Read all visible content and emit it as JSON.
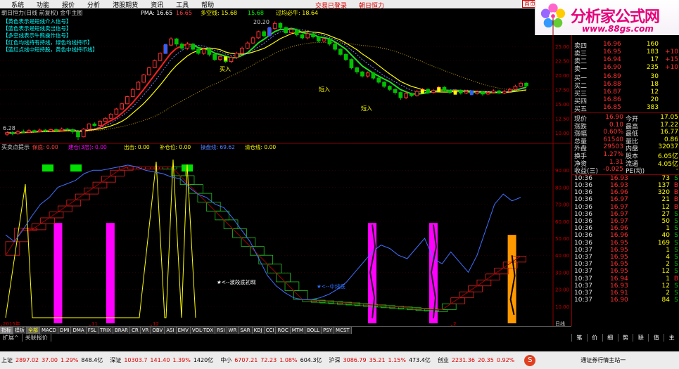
{
  "menu": {
    "items": [
      "系统",
      "功能",
      "报价",
      "分析",
      "港股期货",
      "资讯",
      "工具",
      "帮助"
    ],
    "link1": "交易已登录",
    "link2": "朝日恒力",
    "right_btn": "首页"
  },
  "logo": {
    "title": "分析家公式网",
    "url": "www.88gs.com"
  },
  "main_chart": {
    "header": "朝日恒力(日线 前复权) 金牛主图",
    "pma_label": "PMA: 16.65",
    "pma_val2": "16.65",
    "ma_label": "多空线: 15.68",
    "ma_val2": "15.68",
    "right_label": "过均必牛: 18.64",
    "legend": [
      "【黄色表示是短线介入信号】",
      "【蓝色表示是短线卖出信号】",
      "【多空线表示牛熊操作信号】",
      "【红色均线持有持线，绿色均线持币】",
      "【蓝红点线中短持股，黄色中线持币线】"
    ],
    "peak_label": "20.20",
    "low_label": "6.28",
    "entry_labels": [
      "买入",
      "短入",
      "短入"
    ],
    "y_ticks": [
      "25.00",
      "22.50",
      "20.00",
      "17.50",
      "15.00",
      "12.50",
      "10.00"
    ],
    "candles": [
      {
        "o": 7.5,
        "c": 7.8,
        "h": 8.0,
        "l": 7.2
      },
      {
        "o": 7.8,
        "c": 7.6,
        "h": 8.1,
        "l": 7.3
      },
      {
        "o": 7.6,
        "c": 8.0,
        "h": 8.3,
        "l": 7.4
      },
      {
        "o": 8.0,
        "c": 7.9,
        "h": 8.4,
        "l": 7.7
      },
      {
        "o": 7.9,
        "c": 8.2,
        "h": 8.5,
        "l": 7.8
      },
      {
        "o": 8.2,
        "c": 8.0,
        "h": 8.4,
        "l": 7.8
      },
      {
        "o": 8.0,
        "c": 8.3,
        "h": 8.6,
        "l": 7.9
      },
      {
        "o": 8.3,
        "c": 8.1,
        "h": 8.5,
        "l": 7.9
      },
      {
        "o": 8.1,
        "c": 8.4,
        "h": 8.6,
        "l": 8.0
      },
      {
        "o": 8.4,
        "c": 8.2,
        "h": 8.6,
        "l": 8.0
      },
      {
        "o": 8.2,
        "c": 8.5,
        "h": 8.8,
        "l": 8.1
      },
      {
        "o": 8.5,
        "c": 8.4,
        "h": 8.7,
        "l": 8.2
      },
      {
        "o": 8.4,
        "c": 8.0,
        "h": 8.6,
        "l": 7.6
      },
      {
        "o": 8.0,
        "c": 7.0,
        "h": 8.1,
        "l": 6.4
      },
      {
        "o": 7.0,
        "c": 8.5,
        "h": 8.7,
        "l": 6.9
      },
      {
        "o": 8.5,
        "c": 9.5,
        "h": 9.7,
        "l": 8.4
      },
      {
        "o": 9.5,
        "c": 9.2,
        "h": 9.8,
        "l": 9.0
      },
      {
        "o": 9.2,
        "c": 10.0,
        "h": 10.2,
        "l": 9.1
      },
      {
        "o": 10.0,
        "c": 10.6,
        "h": 10.8,
        "l": 9.9
      },
      {
        "o": 10.6,
        "c": 11.4,
        "h": 11.6,
        "l": 10.5
      },
      {
        "o": 11.4,
        "c": 12.4,
        "h": 12.6,
        "l": 11.3
      },
      {
        "o": 12.4,
        "c": 13.4,
        "h": 13.6,
        "l": 12.3
      },
      {
        "o": 13.4,
        "c": 14.8,
        "h": 15.0,
        "l": 13.3
      },
      {
        "o": 14.8,
        "c": 16.2,
        "h": 16.4,
        "l": 14.7
      },
      {
        "o": 16.2,
        "c": 17.6,
        "h": 17.8,
        "l": 16.1
      },
      {
        "o": 17.6,
        "c": 19.0,
        "h": 19.2,
        "l": 17.5
      },
      {
        "o": 19.0,
        "c": 20.4,
        "h": 20.6,
        "l": 18.9
      },
      {
        "o": 20.4,
        "c": 21.8,
        "h": 22.0,
        "l": 20.3
      },
      {
        "o": 21.8,
        "c": 23.2,
        "h": 23.4,
        "l": 21.7
      },
      {
        "o": 23.2,
        "c": 24.8,
        "h": 25.0,
        "l": 23.1
      },
      {
        "o": 24.8,
        "c": 26.0,
        "h": 26.3,
        "l": 24.6
      },
      {
        "o": 26.0,
        "c": 25.0,
        "h": 26.2,
        "l": 24.5
      },
      {
        "o": 25.0,
        "c": 24.2,
        "h": 25.3,
        "l": 23.9
      },
      {
        "o": 24.2,
        "c": 25.0,
        "h": 25.4,
        "l": 23.9
      },
      {
        "o": 25.0,
        "c": 24.0,
        "h": 25.2,
        "l": 23.7
      },
      {
        "o": 24.0,
        "c": 23.2,
        "h": 24.3,
        "l": 22.9
      },
      {
        "o": 23.2,
        "c": 24.0,
        "h": 24.3,
        "l": 22.9
      },
      {
        "o": 24.0,
        "c": 23.0,
        "h": 24.2,
        "l": 22.6
      },
      {
        "o": 23.0,
        "c": 22.0,
        "h": 23.3,
        "l": 21.7
      },
      {
        "o": 22.0,
        "c": 22.6,
        "h": 23.0,
        "l": 21.7
      },
      {
        "o": 22.6,
        "c": 21.6,
        "h": 22.8,
        "l": 21.3
      },
      {
        "o": 21.6,
        "c": 22.4,
        "h": 22.7,
        "l": 21.3
      },
      {
        "o": 22.4,
        "c": 23.2,
        "h": 23.5,
        "l": 22.1
      },
      {
        "o": 23.2,
        "c": 24.2,
        "h": 24.5,
        "l": 23.0
      },
      {
        "o": 24.2,
        "c": 25.2,
        "h": 25.5,
        "l": 24.0
      },
      {
        "o": 25.2,
        "c": 26.2,
        "h": 26.5,
        "l": 25.0
      },
      {
        "o": 26.2,
        "c": 27.4,
        "h": 27.6,
        "l": 26.0
      },
      {
        "o": 27.4,
        "c": 26.6,
        "h": 27.7,
        "l": 26.3
      },
      {
        "o": 26.6,
        "c": 28.0,
        "h": 28.3,
        "l": 26.5
      },
      {
        "o": 28.0,
        "c": 29.0,
        "h": 29.4,
        "l": 27.8
      },
      {
        "o": 29.0,
        "c": 28.2,
        "h": 29.2,
        "l": 27.9
      },
      {
        "o": 28.2,
        "c": 27.2,
        "h": 28.4,
        "l": 26.9
      },
      {
        "o": 27.2,
        "c": 27.8,
        "h": 28.1,
        "l": 26.9
      },
      {
        "o": 27.8,
        "c": 26.8,
        "h": 28.0,
        "l": 26.5
      },
      {
        "o": 26.8,
        "c": 26.2,
        "h": 27.0,
        "l": 25.9
      },
      {
        "o": 26.2,
        "c": 27.0,
        "h": 27.3,
        "l": 25.9
      },
      {
        "o": 27.0,
        "c": 26.4,
        "h": 27.2,
        "l": 26.1
      },
      {
        "o": 26.4,
        "c": 25.6,
        "h": 26.6,
        "l": 25.3
      },
      {
        "o": 25.6,
        "c": 26.0,
        "h": 26.3,
        "l": 25.3
      },
      {
        "o": 26.0,
        "c": 25.0,
        "h": 26.2,
        "l": 24.7
      },
      {
        "o": 25.0,
        "c": 24.0,
        "h": 25.2,
        "l": 23.7
      },
      {
        "o": 24.0,
        "c": 23.0,
        "h": 24.2,
        "l": 22.7
      },
      {
        "o": 23.0,
        "c": 22.0,
        "h": 23.2,
        "l": 21.7
      },
      {
        "o": 22.0,
        "c": 20.4,
        "h": 22.2,
        "l": 20.1
      },
      {
        "o": 20.4,
        "c": 19.6,
        "h": 20.6,
        "l": 19.2
      },
      {
        "o": 19.6,
        "c": 18.8,
        "h": 19.8,
        "l": 18.5
      },
      {
        "o": 18.8,
        "c": 19.4,
        "h": 19.7,
        "l": 18.5
      },
      {
        "o": 19.4,
        "c": 18.4,
        "h": 19.6,
        "l": 18.1
      },
      {
        "o": 18.4,
        "c": 17.6,
        "h": 18.6,
        "l": 17.3
      },
      {
        "o": 17.6,
        "c": 16.8,
        "h": 17.8,
        "l": 16.5
      },
      {
        "o": 16.8,
        "c": 16.2,
        "h": 17.0,
        "l": 15.9
      },
      {
        "o": 16.2,
        "c": 15.6,
        "h": 16.4,
        "l": 15.2
      },
      {
        "o": 15.6,
        "c": 14.6,
        "h": 15.8,
        "l": 14.2
      },
      {
        "o": 14.6,
        "c": 15.4,
        "h": 15.7,
        "l": 14.3
      },
      {
        "o": 15.4,
        "c": 15.0,
        "h": 15.6,
        "l": 14.7
      },
      {
        "o": 15.0,
        "c": 15.8,
        "h": 16.1,
        "l": 14.8
      },
      {
        "o": 15.8,
        "c": 16.2,
        "h": 16.5,
        "l": 15.5
      },
      {
        "o": 16.2,
        "c": 15.6,
        "h": 16.4,
        "l": 15.3
      },
      {
        "o": 15.6,
        "c": 16.0,
        "h": 16.3,
        "l": 15.4
      },
      {
        "o": 16.0,
        "c": 16.6,
        "h": 16.9,
        "l": 15.8
      },
      {
        "o": 16.6,
        "c": 16.0,
        "h": 16.8,
        "l": 15.7
      },
      {
        "o": 16.0,
        "c": 15.6,
        "h": 16.2,
        "l": 15.3
      },
      {
        "o": 15.6,
        "c": 16.0,
        "h": 16.3,
        "l": 15.4
      },
      {
        "o": 16.0,
        "c": 15.5,
        "h": 16.2,
        "l": 15.2
      },
      {
        "o": 15.5,
        "c": 15.8,
        "h": 16.1,
        "l": 15.3
      },
      {
        "o": 15.8,
        "c": 15.4,
        "h": 16.0,
        "l": 15.1
      },
      {
        "o": 15.4,
        "c": 15.7,
        "h": 16.0,
        "l": 15.2
      },
      {
        "o": 15.7,
        "c": 15.3,
        "h": 15.9,
        "l": 15.0
      },
      {
        "o": 15.3,
        "c": 15.6,
        "h": 15.9,
        "l": 15.1
      },
      {
        "o": 15.6,
        "c": 15.9,
        "h": 16.2,
        "l": 15.4
      },
      {
        "o": 15.9,
        "c": 15.5,
        "h": 16.1,
        "l": 15.3
      },
      {
        "o": 15.5,
        "c": 15.8,
        "h": 16.1,
        "l": 15.3
      },
      {
        "o": 15.8,
        "c": 16.2,
        "h": 16.5,
        "l": 15.6
      },
      {
        "o": 16.2,
        "c": 16.8,
        "h": 17.1,
        "l": 16.0
      },
      {
        "o": 16.8,
        "c": 17.4,
        "h": 17.7,
        "l": 16.6
      },
      {
        "o": 17.4,
        "c": 16.9,
        "h": 17.6,
        "l": 16.6
      }
    ]
  },
  "sub_chart": {
    "header": "买卖点提示",
    "fields": [
      {
        "label": "保底:",
        "value": "0.00",
        "color": "#ff4040"
      },
      {
        "label": "建仓(3层):",
        "value": "0.00",
        "color": "#ff00ff"
      },
      {
        "label": "出击:",
        "value": "0.00",
        "color": "#ffff00"
      },
      {
        "label": "补仓位:",
        "value": "0.00",
        "color": "#ffff00"
      },
      {
        "label": "操盘线:",
        "value": "69.62",
        "color": "#5080ff"
      },
      {
        "label": "清仓线:",
        "value": "0.00",
        "color": "#ffff00"
      }
    ],
    "annotation1": "★<--波段底初现",
    "annotation2": "★<--中线底",
    "y_ticks": [
      "90.00",
      "80.00",
      "70.00",
      "60.00",
      "50.00",
      "40.00",
      "30.00",
      "20.00",
      "10.00"
    ],
    "x_labels": [
      "2015年",
      "11",
      "12",
      "2"
    ],
    "x_unit": "日线",
    "blue_line": [
      52,
      48,
      55,
      63,
      70,
      74,
      80,
      82,
      84,
      88,
      90,
      90,
      91,
      92,
      93,
      92,
      90,
      89,
      88,
      86,
      85,
      80,
      76,
      74,
      70,
      68,
      62,
      55,
      48,
      38,
      28,
      22,
      18,
      15,
      14,
      14,
      15,
      17,
      20,
      24,
      30,
      36,
      42,
      46,
      44,
      40,
      38,
      44,
      50,
      38,
      35,
      42,
      36,
      30,
      40,
      55,
      70,
      76,
      72,
      74
    ],
    "pink_bars": [
      6,
      12,
      42,
      49
    ],
    "orange_bar": 58
  },
  "quote": {
    "asks": [
      {
        "label": "卖四",
        "price": "16.96",
        "vol": "160",
        "chg": ""
      },
      {
        "label": "卖三",
        "price": "16.95",
        "vol": "183",
        "chg": "+10"
      },
      {
        "label": "卖二",
        "price": "16.94",
        "vol": "17",
        "chg": "+15"
      },
      {
        "label": "卖一",
        "price": "16.90",
        "vol": "235",
        "chg": "+10"
      }
    ],
    "bids": [
      {
        "label": "买一",
        "price": "16.89",
        "vol": "30",
        "chg": ""
      },
      {
        "label": "买二",
        "price": "16.88",
        "vol": "18",
        "chg": ""
      },
      {
        "label": "买三",
        "price": "16.87",
        "vol": "12",
        "chg": ""
      },
      {
        "label": "买四",
        "price": "16.86",
        "vol": "20",
        "chg": ""
      },
      {
        "label": "买五",
        "price": "16.85",
        "vol": "383",
        "chg": ""
      }
    ],
    "stats": [
      {
        "k1": "现价",
        "v1": "16.90",
        "k2": "今开",
        "v2": "17.05"
      },
      {
        "k1": "涨跌",
        "v1": "0.10",
        "k2": "最高",
        "v2": "17.22"
      },
      {
        "k1": "涨幅",
        "v1": "0.60%",
        "k2": "最低",
        "v2": "16.77"
      },
      {
        "k1": "总量",
        "v1": "61540",
        "k2": "量比",
        "v2": "0.86"
      },
      {
        "k1": "外盘",
        "v1": "29503",
        "k2": "内盘",
        "v2": "32037"
      },
      {
        "k1": "换手",
        "v1": "1.27%",
        "k2": "股本",
        "v2": "6.05亿"
      },
      {
        "k1": "净资",
        "v1": "1.31",
        "k2": "流通",
        "v2": "4.05亿"
      },
      {
        "k1": "收益(三)",
        "v1": "-0.025",
        "k2": "PE(动)",
        "v2": "-"
      }
    ],
    "ticks": [
      {
        "t": "10:36",
        "p": "16.93",
        "v": "73",
        "s": "S"
      },
      {
        "t": "10:36",
        "p": "16.93",
        "v": "137",
        "s": "B"
      },
      {
        "t": "10:36",
        "p": "16.96",
        "v": "320",
        "s": "B"
      },
      {
        "t": "10:36",
        "p": "16.97",
        "v": "21",
        "s": "B"
      },
      {
        "t": "10:36",
        "p": "16.97",
        "v": "12",
        "s": "B"
      },
      {
        "t": "10:36",
        "p": "16.97",
        "v": "27",
        "s": "S"
      },
      {
        "t": "10:36",
        "p": "16.97",
        "v": "50",
        "s": "S"
      },
      {
        "t": "10:36",
        "p": "16.96",
        "v": "1",
        "s": "S"
      },
      {
        "t": "10:36",
        "p": "16.96",
        "v": "40",
        "s": "S"
      },
      {
        "t": "10:36",
        "p": "16.95",
        "v": "169",
        "s": "S"
      },
      {
        "t": "10:37",
        "p": "16.95",
        "v": "1",
        "s": "S"
      },
      {
        "t": "10:37",
        "p": "16.95",
        "v": "4",
        "s": "S"
      },
      {
        "t": "10:37",
        "p": "16.95",
        "v": "2",
        "s": "S"
      },
      {
        "t": "10:37",
        "p": "16.95",
        "v": "12",
        "s": "S"
      },
      {
        "t": "10:37",
        "p": "16.94",
        "v": "1",
        "s": "B"
      },
      {
        "t": "10:37",
        "p": "16.93",
        "v": "12",
        "s": "S"
      },
      {
        "t": "10:37",
        "p": "16.91",
        "v": "2",
        "s": "S"
      },
      {
        "t": "10:37",
        "p": "16.90",
        "v": "84",
        "s": "S"
      }
    ]
  },
  "tabs": [
    "指标",
    "模板",
    "全部",
    "MACD",
    "DMI",
    "DMA",
    "FSL",
    "TRIX",
    "BRAR",
    "CR",
    "VR",
    "OBV",
    "ASI",
    "EMV",
    "VOL-TDX",
    "RSI",
    "WR",
    "SAR",
    "KDJ",
    "CCI",
    "ROC",
    "MTM",
    "BOLL",
    "PSY",
    "MCST"
  ],
  "tabs2": [
    "扩展^",
    "关联报价"
  ],
  "rp_tabs": [
    "笔",
    "价",
    "细",
    "势",
    "联",
    "值",
    "主"
  ],
  "status": [
    {
      "name": "上证",
      "val": "2897.02",
      "chg": "37.00",
      "pct": "1.29%",
      "amt": "848.4亿",
      "dir": "up"
    },
    {
      "name": "深证",
      "val": "10303.7",
      "chg": "141.40",
      "pct": "1.39%",
      "amt": "1420亿",
      "dir": "up"
    },
    {
      "name": "中小",
      "val": "6707.21",
      "chg": "72.23",
      "pct": "1.08%",
      "amt": "604.3亿",
      "dir": "up"
    },
    {
      "name": "沪深",
      "val": "3086.79",
      "chg": "35.21",
      "pct": "1.15%",
      "amt": "473.4亿",
      "dir": "up"
    },
    {
      "name": "创业",
      "val": "2231.36",
      "chg": "20.35",
      "pct": "0.92%",
      "amt": "",
      "dir": "up"
    }
  ],
  "status_right": "通证券行情主站一",
  "colors": {
    "up": "#ff3030",
    "down": "#00c000",
    "grid": "#800000",
    "yellow": "#ffff00",
    "cyan": "#00ffff",
    "magenta": "#ff00ff"
  }
}
